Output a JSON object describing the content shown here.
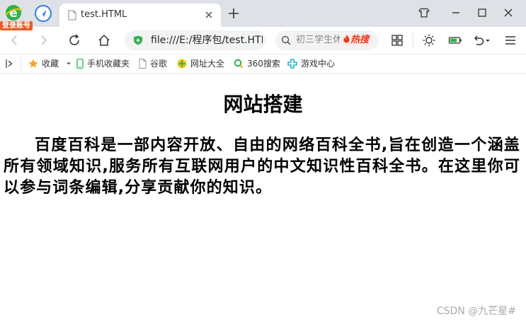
{
  "browser": {
    "login_badge": "登录账号",
    "tab_title": "test.HTML",
    "address_url": "file:///E:/程序包/test.HTML",
    "search_placeholder": "初三学生休",
    "search_hot_label": "热搜",
    "bookmarks": {
      "favorites": "收藏",
      "mobile_favorites": "手机收藏夹",
      "google": "谷歌",
      "url_directory": "网址大全",
      "search_360": "360搜索",
      "game_center": "游戏中心"
    }
  },
  "page": {
    "heading": "网站搭建",
    "paragraph": "百度百科是一部内容开放、自由的网络百科全书,旨在创造一个涵盖所有领域知识,服务所有互联网用户的中文知识性百科全书。在这里你可以参与词条编辑,分享贡献你的知识。"
  },
  "watermark": "CSDN @九芒星#",
  "colors": {
    "tab_bar": "#dee1e6",
    "secure_green": "#2fb24a",
    "hot_red": "#e8381c",
    "login_badge": "#ee5a24",
    "star_orange": "#f5a623"
  }
}
